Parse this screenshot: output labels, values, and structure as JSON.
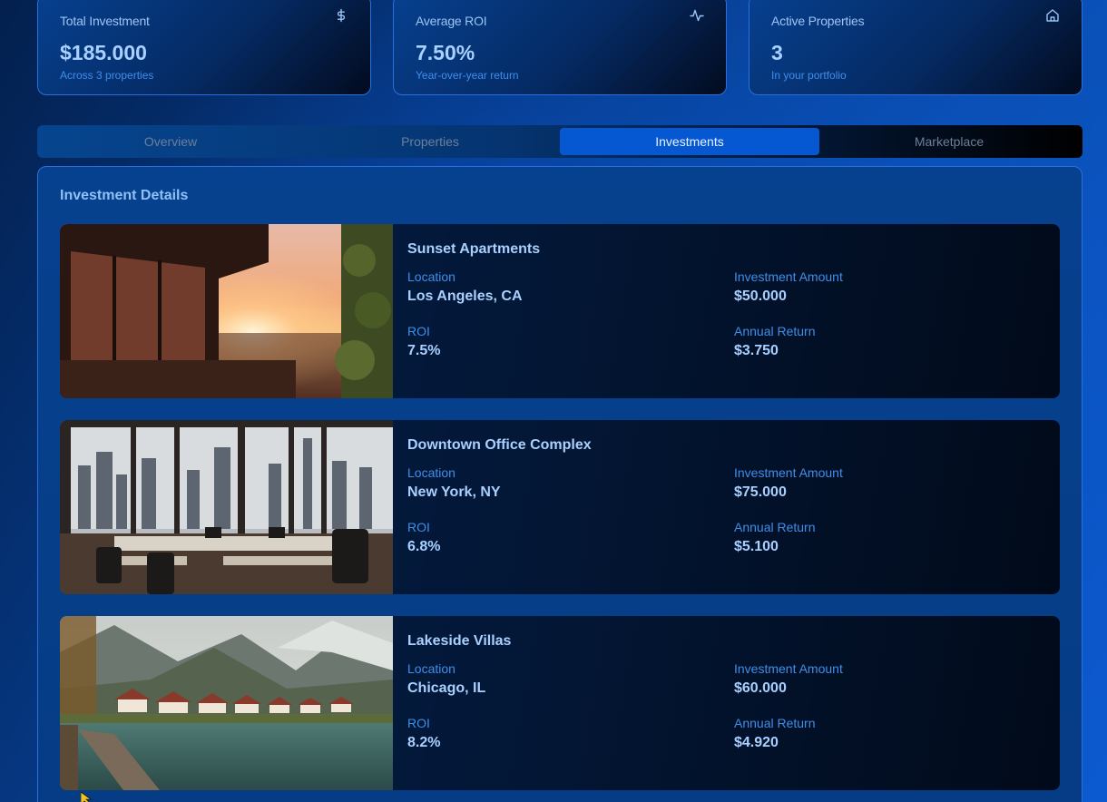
{
  "stats": [
    {
      "title": "Total Investment",
      "value": "$185.000",
      "subtitle": "Across 3 properties",
      "icon": "dollar-icon"
    },
    {
      "title": "Average ROI",
      "value": "7.50%",
      "subtitle": "Year-over-year return",
      "icon": "activity-icon"
    },
    {
      "title": "Active Properties",
      "value": "3",
      "subtitle": "In your portfolio",
      "icon": "home-icon"
    }
  ],
  "tabs": [
    {
      "label": "Overview",
      "active": false
    },
    {
      "label": "Properties",
      "active": false
    },
    {
      "label": "Investments",
      "active": true
    },
    {
      "label": "Marketplace",
      "active": false
    }
  ],
  "details": {
    "title": "Investment Details",
    "labels": {
      "location": "Location",
      "investment_amount": "Investment Amount",
      "roi": "ROI",
      "annual_return": "Annual Return"
    },
    "properties": [
      {
        "name": "Sunset Apartments",
        "location": "Los Angeles, CA",
        "investment_amount": "$50.000",
        "roi": "7.5%",
        "annual_return": "$3.750",
        "image": "sunset-apartment-balcony-photo"
      },
      {
        "name": "Downtown Office Complex",
        "location": "New York, NY",
        "investment_amount": "$75.000",
        "roi": "6.8%",
        "annual_return": "$5.100",
        "image": "city-office-interior-photo"
      },
      {
        "name": "Lakeside Villas",
        "location": "Chicago, IL",
        "investment_amount": "$60.000",
        "roi": "8.2%",
        "annual_return": "$4.920",
        "image": "mountain-lake-villas-photo"
      }
    ]
  },
  "colors": {
    "accent": "#0658d2",
    "label_blue": "#3f8ee8",
    "value_blue": "#a9d0ff",
    "border": "#2a6fdc"
  }
}
